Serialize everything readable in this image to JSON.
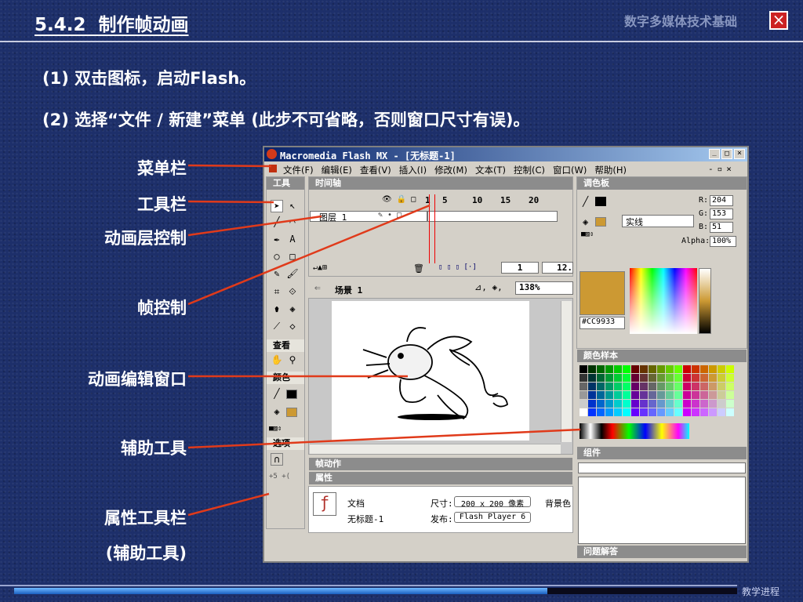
{
  "slide": {
    "section": "5.4.2",
    "title": "制作帧动画",
    "course": "数字多媒体技术基础",
    "steps": [
      "(1) 双击图标，启动Flash。",
      "(2) 选择“文件 / 新建”菜单 (此步不可省略，否则窗口尺寸有误)。"
    ],
    "footer_label": "教学进程"
  },
  "labels": [
    "菜单栏",
    "工具栏",
    "动画层控制",
    "帧控制",
    "动画编辑窗口",
    "辅助工具",
    "属性工具栏",
    "(辅助工具)"
  ],
  "colors": {
    "accent_line": "#e03a1a",
    "background": "#1d2f6a",
    "highlight_color": "#CC9933"
  },
  "flash": {
    "window_title": "Macromedia Flash MX - [无标题-1]",
    "menu": [
      "文件(F)",
      "编辑(E)",
      "查看(V)",
      "插入(I)",
      "修改(M)",
      "文本(T)",
      "控制(C)",
      "窗口(W)",
      "帮助(H)"
    ],
    "panels": {
      "tools": "工具",
      "view": "查看",
      "colors": "颜色",
      "options": "选项",
      "timeline": "时间轴",
      "mixer": "调色板",
      "swatches": "颜色样本",
      "components": "组件",
      "actions": "帧动作",
      "properties": "属性",
      "answers": "问题解答"
    },
    "layer": "图层 1",
    "frame_numbers": [
      "1",
      "5",
      "10",
      "15",
      "20"
    ],
    "current_frame": "1",
    "fps": "12.",
    "scene": "场景 1",
    "zoom": "138%",
    "fill_style": "实线",
    "rgb": {
      "r": "R:",
      "g": "G:",
      "b": "B:",
      "alpha": "Alpha:",
      "rv": "204",
      "gv": "153",
      "bv": "51",
      "av": "100%"
    },
    "hex": "#CC9933",
    "props": {
      "doc": "文档",
      "name": "无标题-1",
      "size_label": "尺寸:",
      "size": "200 x 200 像素",
      "bg": "背景色",
      "publish_label": "发布:",
      "publish": "Flash Player 6"
    }
  }
}
